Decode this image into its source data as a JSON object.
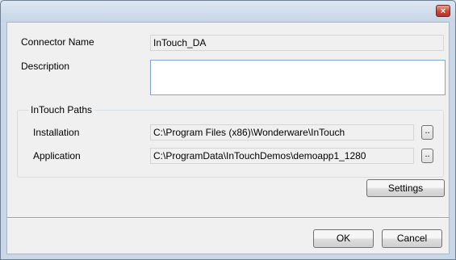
{
  "window": {
    "close_glyph": "×"
  },
  "form": {
    "connector_name_label": "Connector Name",
    "connector_name_value": "InTouch_DA",
    "description_label": "Description",
    "description_value": ""
  },
  "paths_group": {
    "title": "InTouch Paths",
    "installation_label": "Installation",
    "installation_value": "C:\\Program Files (x86)\\Wonderware\\InTouch",
    "application_label": "Application",
    "application_value": "C:\\ProgramData\\InTouchDemos\\demoapp1_1280",
    "browse_label": ".."
  },
  "buttons": {
    "settings": "Settings",
    "ok": "OK",
    "cancel": "Cancel"
  }
}
